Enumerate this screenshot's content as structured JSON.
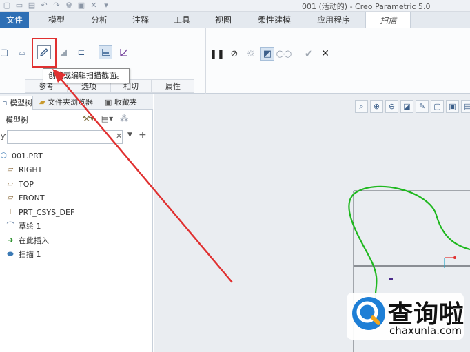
{
  "window": {
    "title": "001 (活动的) - Creo Parametric 5.0",
    "quick_access_icons": [
      "new-icon",
      "open-icon",
      "save-icon",
      "undo-icon",
      "redo-icon",
      "regenerate-icon",
      "windows-icon",
      "close-icon",
      "customize-icon"
    ]
  },
  "ribbon_tabs": {
    "file": "文件",
    "model": "模型",
    "analysis": "分析",
    "annotate": "注释",
    "tools": "工具",
    "view": "视图",
    "flexible": "柔性建模",
    "applications": "应用程序",
    "sweep": "扫描"
  },
  "ribbon": {
    "group_labels": {
      "references": "参考",
      "options": "选项",
      "tangency": "相切",
      "properties": "属性"
    },
    "buttons": {
      "solid": "solid-icon",
      "surface": "surface-icon",
      "sketch": "sketch-edit-icon",
      "remove": "remove-material-icon",
      "thicken": "thicken-icon",
      "constant": "constant-section-icon",
      "variable": "variable-section-icon",
      "pause": "pause-icon",
      "no_preview": "no-preview-icon",
      "preview_sep": "separate-preview-icon",
      "preview_verify": "verify-preview-icon",
      "glasses": "preview-glasses-icon",
      "ok": "check-icon",
      "cancel": "cancel-icon"
    }
  },
  "tooltip": {
    "text": "创建或编辑扫描截面。"
  },
  "panel": {
    "tabs": {
      "model_tree": "模型树",
      "folder_browser": "文件夹浏览器",
      "favorites": "收藏夹"
    },
    "header": "模型树",
    "filter_placeholder": "",
    "tree": [
      {
        "label": "001.PRT",
        "icon": "part-icon"
      },
      {
        "label": "RIGHT",
        "icon": "datum-plane-icon"
      },
      {
        "label": "TOP",
        "icon": "datum-plane-icon"
      },
      {
        "label": "FRONT",
        "icon": "datum-plane-icon"
      },
      {
        "label": "PRT_CSYS_DEF",
        "icon": "csys-icon"
      },
      {
        "label": "草绘 1",
        "icon": "sketch-icon"
      },
      {
        "label": "在此插入",
        "icon": "insert-arrow-icon"
      },
      {
        "label": "扫描 1",
        "icon": "sweep-icon"
      }
    ]
  },
  "view_toolbar": [
    "refit-icon",
    "zoom-in-icon",
    "zoom-out-icon",
    "repaint-icon",
    "spin-icon",
    "display-style-icon",
    "saved-views-icon",
    "view-manager-icon"
  ],
  "colors": {
    "file_tab": "#2e6fb5",
    "trajectory": "#1fb81f",
    "annotation_arrow": "#e03030",
    "highlight": "#e03030"
  },
  "watermark": {
    "text": "查询啦",
    "url": "chaxunla.com"
  }
}
